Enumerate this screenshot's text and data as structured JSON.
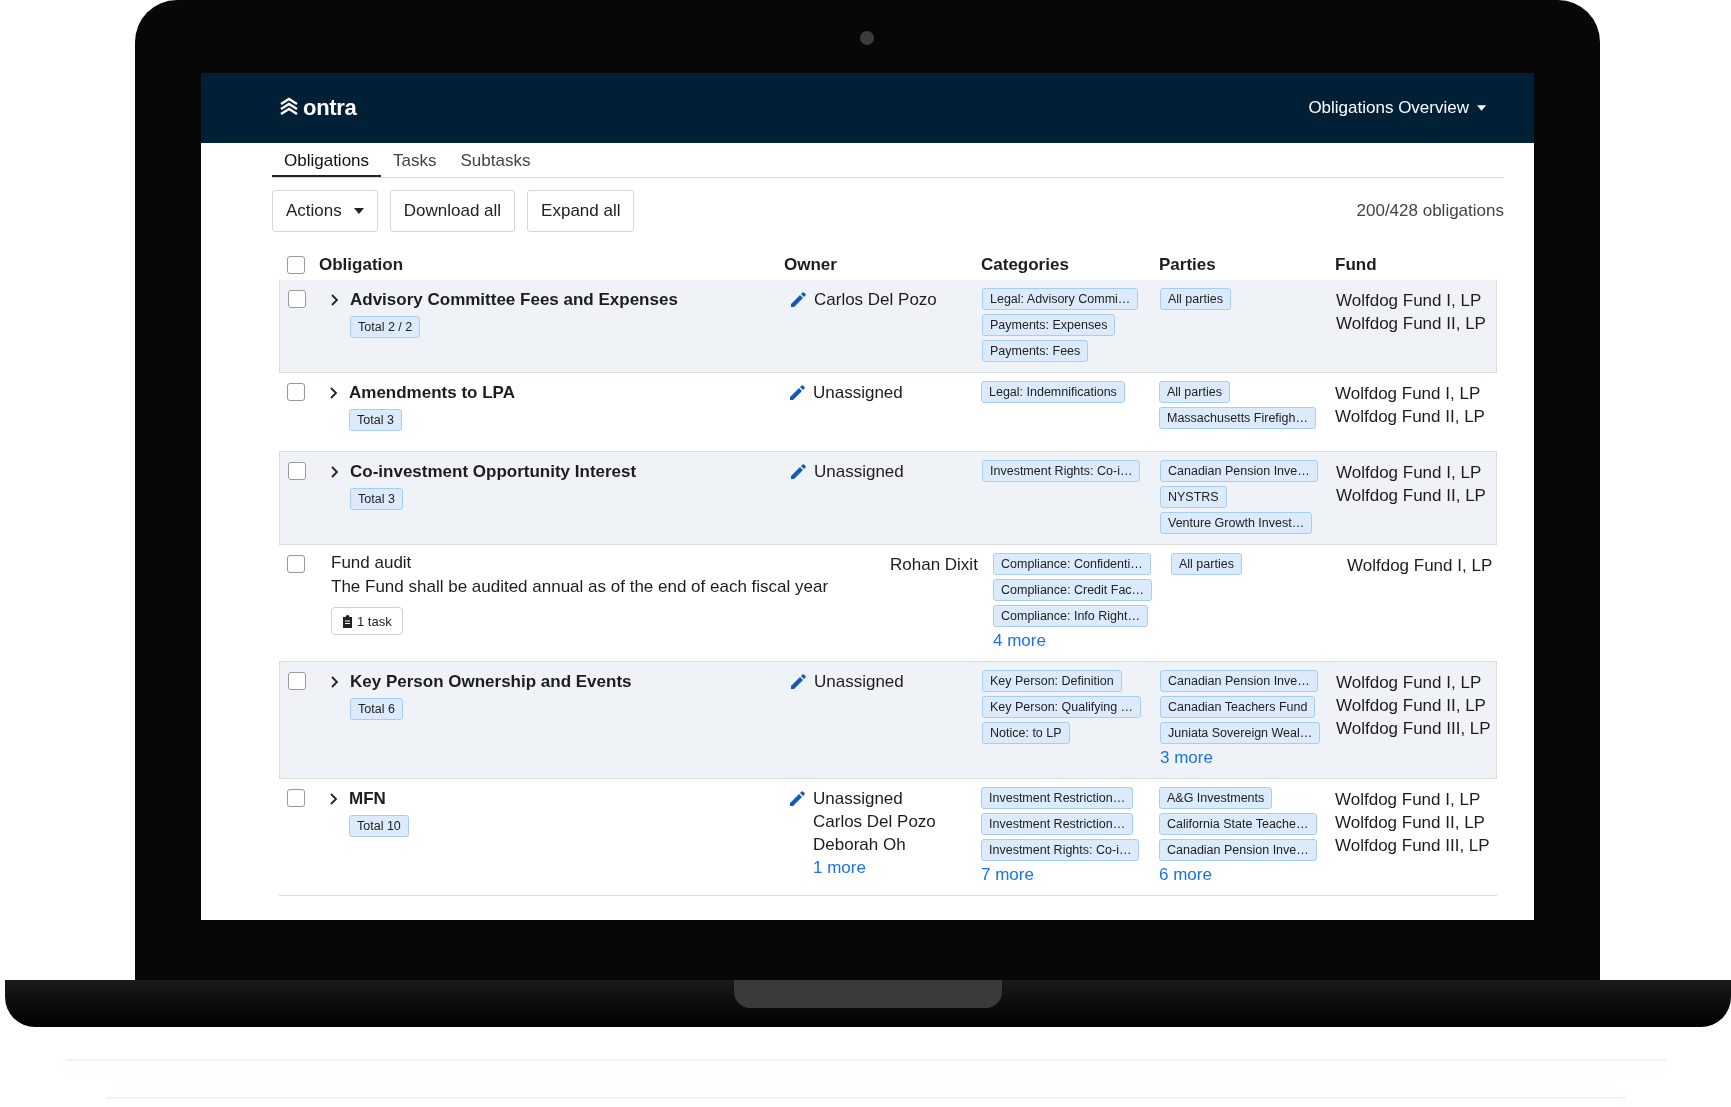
{
  "header": {
    "logo": "ontra",
    "view_menu": "Obligations Overview"
  },
  "tabs": [
    {
      "label": "Obligations",
      "selected": true
    },
    {
      "label": "Tasks",
      "selected": false
    },
    {
      "label": "Subtasks",
      "selected": false
    }
  ],
  "toolbar": {
    "buttons": [
      {
        "label": "Actions",
        "kind": "dropdown"
      },
      {
        "label": "Download all",
        "kind": "plain"
      },
      {
        "label": "Expand all",
        "kind": "plain"
      }
    ],
    "count": "200/428 obligations"
  },
  "table": {
    "select_all_checked": false,
    "columns": [
      "Obligation",
      "Owner",
      "Categories",
      "Parties",
      "Fund"
    ],
    "rows": [
      {
        "kind": "group",
        "checked": false,
        "expanded": false,
        "title": "Advisory Committee Fees and Expenses",
        "total": "Total 2 / 2",
        "owners": [
          "Carlos Del Pozo"
        ],
        "categories": [
          "Legal: Advisory Commi…",
          "Payments: Expenses",
          "Payments: Fees"
        ],
        "parties": [
          "All parties"
        ],
        "funds": [
          "Wolfdog Fund I, LP",
          "Wolfdog Fund II, LP"
        ]
      },
      {
        "kind": "group",
        "checked": false,
        "expanded": false,
        "title": "Amendments to LPA",
        "total": "Total 3",
        "owners": [
          "Unassigned"
        ],
        "categories": [
          "Legal: Indemnifications"
        ],
        "parties": [
          "All parties",
          "Massachusetts Firefigh…"
        ],
        "funds": [
          "Wolfdog Fund I, LP",
          "Wolfdog Fund II, LP"
        ]
      },
      {
        "kind": "group",
        "checked": false,
        "expanded": false,
        "title": "Co-investment Opportunity Interest",
        "total": "Total 3",
        "owners": [
          "Unassigned"
        ],
        "categories": [
          "Investment Rights: Co-i…"
        ],
        "parties": [
          "Canadian Pension Inve…",
          "NYSTRS",
          "Venture Growth Invest…"
        ],
        "funds": [
          "Wolfdog Fund I, LP",
          "Wolfdog Fund II, LP"
        ]
      },
      {
        "kind": "task",
        "checked": false,
        "title": "Fund audit",
        "description": "The Fund shall be audited annual as of the end of each fiscal year",
        "task_button": "1 task",
        "owners": [
          "Rohan Dixit"
        ],
        "categories": [
          "Compliance: Confidenti…",
          "Compliance: Credit Fac…",
          "Compliance: Info Right…"
        ],
        "categories_more": "4 more",
        "parties": [
          "All parties"
        ],
        "funds": [
          "Wolfdog Fund I, LP"
        ]
      },
      {
        "kind": "group",
        "checked": false,
        "expanded": false,
        "title": "Key Person Ownership and Events",
        "total": "Total 6",
        "owners": [
          "Unassigned"
        ],
        "categories": [
          "Key Person: Definition",
          "Key Person: Qualifying …",
          "Notice: to LP"
        ],
        "parties": [
          "Canadian Pension Inve…",
          "Canadian Teachers Fund",
          "Juniata Sovereign Weal…"
        ],
        "parties_more": "3 more",
        "funds": [
          "Wolfdog Fund I, LP",
          "Wolfdog Fund II, LP",
          "Wolfdog Fund III, LP"
        ]
      },
      {
        "kind": "group",
        "checked": false,
        "expanded": false,
        "title": "MFN",
        "total": "Total 10",
        "owners": [
          "Unassigned",
          "Carlos Del Pozo",
          "Deborah Oh"
        ],
        "owners_more": "1 more",
        "categories": [
          "Investment Restriction…",
          "Investment Restriction…",
          "Investment Rights: Co-i…"
        ],
        "categories_more": "7 more",
        "parties": [
          "A&G Investments",
          "California State Teache…",
          "Canadian Pension Inve…"
        ],
        "parties_more": "6 more",
        "funds": [
          "Wolfdog Fund I, LP",
          "Wolfdog Fund II, LP",
          "Wolfdog Fund III, LP"
        ]
      }
    ]
  }
}
